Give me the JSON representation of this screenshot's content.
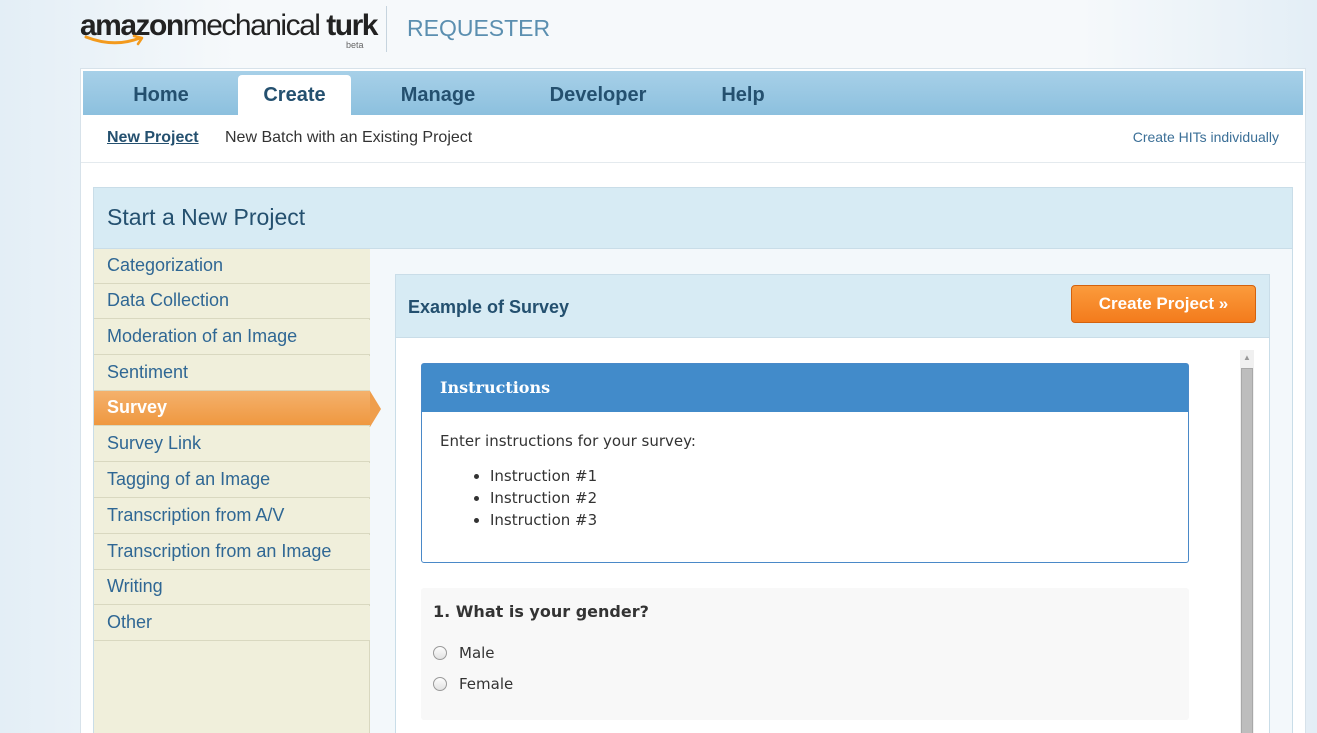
{
  "brand": {
    "logo_part1": "amazon",
    "logo_part2": "mechanical",
    "logo_part3": " turk",
    "beta": "beta",
    "section": "REQUESTER"
  },
  "nav": {
    "tabs": [
      {
        "label": "Home"
      },
      {
        "label": "Create",
        "active": true
      },
      {
        "label": "Manage"
      },
      {
        "label": "Developer"
      },
      {
        "label": "Help"
      }
    ]
  },
  "subnav": {
    "items": [
      {
        "label": "New Project",
        "active": true
      },
      {
        "label": "New Batch with an Existing Project"
      }
    ],
    "right_link": "Create HITs individually"
  },
  "panel": {
    "title": "Start a New Project",
    "templates": [
      "Categorization",
      "Data Collection",
      "Moderation of an Image",
      "Sentiment",
      "Survey",
      "Survey Link",
      "Tagging of an Image",
      "Transcription from A/V",
      "Transcription from an Image",
      "Writing",
      "Other"
    ],
    "selected_template": "Survey"
  },
  "example": {
    "title": "Example of Survey",
    "create_button": "Create Project »",
    "instructions": {
      "heading": "Instructions",
      "intro": "Enter instructions for your survey:",
      "items": [
        "Instruction #1",
        "Instruction #2",
        "Instruction #3"
      ]
    },
    "question": {
      "title": "1. What is your gender?",
      "options": [
        "Male",
        "Female"
      ]
    }
  },
  "colors": {
    "nav_blue": "#8cc0de",
    "link_blue": "#2f6794",
    "accent_orange": "#f37b1c",
    "instructions_blue": "#428bca"
  }
}
